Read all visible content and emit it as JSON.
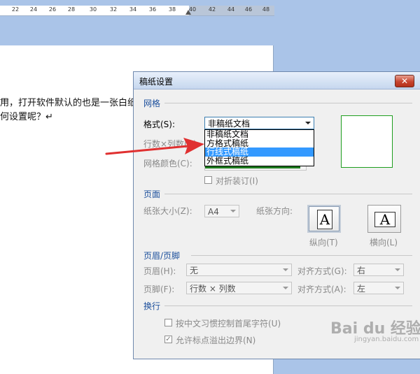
{
  "ruler": {
    "ticks": [
      "22",
      "24",
      "26",
      "28",
      "30",
      "32",
      "34",
      "36",
      "38",
      "40",
      "42",
      "44",
      "46",
      "48"
    ]
  },
  "document": {
    "line1": "用，打开软件默认的也是一张白纸",
    "line2": "何设置呢？↵"
  },
  "dialog": {
    "title": "稿纸设置",
    "close_symbol": "✕",
    "sections": {
      "grid": "网格",
      "page": "页面",
      "header_footer": "页眉/页脚",
      "line_break": "换行"
    },
    "grid": {
      "format_label": "格式(S):",
      "format_value": "非稿纸文档",
      "rows_cols_label": "行数×列数(R):",
      "grid_color_label": "网格颜色(C):",
      "fold_checkbox_label": "对折装订(I)",
      "dropdown_options": [
        "非稿纸文档",
        "方格式稿纸",
        "行线式稿纸",
        "外框式稿纸"
      ],
      "selected_option_index": 2,
      "grid_color": "#1e7a1e"
    },
    "page": {
      "paper_size_label": "纸张大小(Z):",
      "paper_size_value": "A4",
      "orientation_label": "纸张方向:",
      "portrait_label": "纵向(T)",
      "landscape_label": "横向(L)",
      "icon_letter": "A"
    },
    "header_footer": {
      "header_label": "页眉(H):",
      "header_value": "无",
      "header_align_label": "对齐方式(G):",
      "header_align_value": "右",
      "footer_label": "页脚(F):",
      "footer_value": "行数 × 列数",
      "footer_align_label": "对齐方式(A):",
      "footer_align_value": "左"
    },
    "line_break": {
      "option1_label": "按中文习惯控制首尾字符(U)",
      "option1_checked": false,
      "option2_label": "允许标点溢出边界(N)",
      "option2_checked": true
    }
  },
  "watermark": {
    "text": "Bai du 经验",
    "sub": "jingyan.baidu.com"
  },
  "colors": {
    "accent": "#3399ff",
    "section_title": "#1c4f9c",
    "arrow": "#e03030"
  }
}
